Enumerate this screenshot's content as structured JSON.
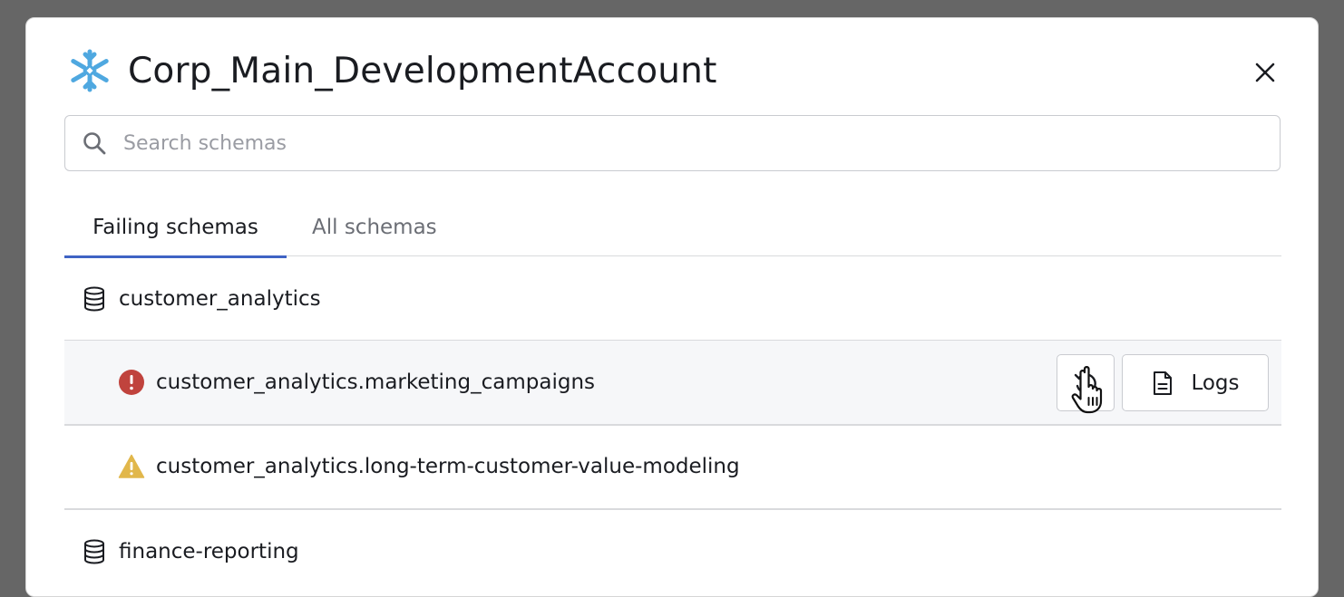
{
  "dialog": {
    "title": "Corp_Main_DevelopmentAccount",
    "logo_icon": "snowflake-icon",
    "close_icon": "close-icon"
  },
  "search": {
    "placeholder": "Search schemas",
    "value": ""
  },
  "tabs": [
    {
      "label": "Failing schemas",
      "active": true
    },
    {
      "label": "All schemas",
      "active": false
    }
  ],
  "groups": [
    {
      "name": "customer_analytics",
      "icon": "database-icon",
      "schemas": [
        {
          "name": "customer_analytics.marketing_campaigns",
          "status": "error",
          "status_icon": "error-icon",
          "status_color": "#c0433d",
          "hovered": true
        },
        {
          "name": "customer_analytics.long-term-customer-value-modeling",
          "status": "warning",
          "status_icon": "warning-icon",
          "status_color": "#e1b74b",
          "hovered": false
        }
      ]
    },
    {
      "name": "finance-reporting",
      "icon": "database-icon",
      "schemas": []
    }
  ],
  "actions": {
    "retry_icon": "retry-icon",
    "logs_label": "Logs",
    "logs_icon": "document-icon"
  },
  "colors": {
    "accent": "#3f63c4",
    "snowflake": "#4fa8e0"
  }
}
